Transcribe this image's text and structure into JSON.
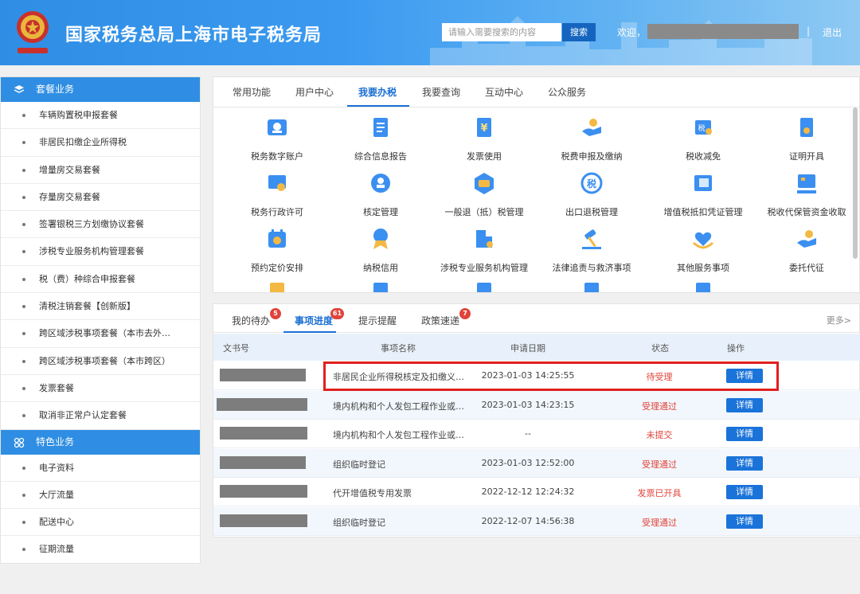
{
  "header": {
    "title": "国家税务总局上海市电子税务局",
    "search_placeholder": "请输入需要搜索的内容",
    "search_button": "搜索",
    "welcome": "欢迎，",
    "separator": "|",
    "logout": "退出"
  },
  "colors": {
    "brand_blue": "#2f8ee3",
    "accent_blue": "#1a6fd4",
    "status_red": "#e0443a",
    "highlight_red": "#e02020"
  },
  "sidebar": {
    "section1": {
      "title": "套餐业务",
      "icon": "layers-icon"
    },
    "items1": [
      "车辆购置税申报套餐",
      "非居民扣缴企业所得税",
      "增量房交易套餐",
      "存量房交易套餐",
      "签署银税三方划缴协议套餐",
      "涉税专业服务机构管理套餐",
      "税（费）种综合申报套餐",
      "清税注销套餐【创新版】",
      "跨区域涉税事项套餐（本市去外…",
      "跨区域涉税事项套餐（本市跨区）",
      "发票套餐",
      "取消非正常户认定套餐"
    ],
    "section2": {
      "title": "特色业务",
      "icon": "grid-icon"
    },
    "items2": [
      "电子资料",
      "大厅流量",
      "配送中心",
      "征期流量"
    ]
  },
  "top_tabs": [
    "常用功能",
    "用户中心",
    "我要办税",
    "我要查询",
    "互动中心",
    "公众服务"
  ],
  "top_tabs_active": "我要办税",
  "services": [
    {
      "label": "税务数字账户",
      "icon": "digital-account-icon"
    },
    {
      "label": "综合信息报告",
      "icon": "report-icon"
    },
    {
      "label": "发票使用",
      "icon": "invoice-icon"
    },
    {
      "label": "税费申报及缴纳",
      "icon": "payment-hand-icon"
    },
    {
      "label": "税收减免",
      "icon": "tax-relief-icon"
    },
    {
      "label": "证明开具",
      "icon": "certificate-icon"
    },
    {
      "label": "税务行政许可",
      "icon": "license-icon"
    },
    {
      "label": "核定管理",
      "icon": "stamp-icon"
    },
    {
      "label": "一般退（抵）税管理",
      "icon": "refund-icon"
    },
    {
      "label": "出口退税管理",
      "icon": "export-refund-icon"
    },
    {
      "label": "增值税抵扣凭证管理",
      "icon": "voucher-icon"
    },
    {
      "label": "税收代保管资金收取",
      "icon": "custody-icon"
    },
    {
      "label": "预约定价安排",
      "icon": "calendar-icon"
    },
    {
      "label": "纳税信用",
      "icon": "credit-medal-icon"
    },
    {
      "label": "涉税专业服务机构管理",
      "icon": "building-gear-icon"
    },
    {
      "label": "法律追责与救济事项",
      "icon": "gavel-icon"
    },
    {
      "label": "其他服务事项",
      "icon": "heart-hand-icon"
    },
    {
      "label": "委托代征",
      "icon": "entrust-icon"
    }
  ],
  "progress_tabs": [
    {
      "label": "我的待办",
      "badge": "5"
    },
    {
      "label": "事项进度",
      "badge": "61"
    },
    {
      "label": "提示提醒",
      "badge": ""
    },
    {
      "label": "政策速递",
      "badge": "7"
    }
  ],
  "progress_tabs_active": "事项进度",
  "more": "更多>",
  "table": {
    "headers": [
      "文书号",
      "事项名称",
      "申请日期",
      "状态",
      "操作"
    ],
    "rows": [
      {
        "name": "非居民企业所得税核定及扣缴义…",
        "date": "2023-01-03 14:25:55",
        "status": "待受理",
        "action": "详情"
      },
      {
        "name": "境内机构和个人发包工程作业或…",
        "date": "2023-01-03 14:23:15",
        "status": "受理通过",
        "action": "详情"
      },
      {
        "name": "境内机构和个人发包工程作业或…",
        "date": "--",
        "status": "未提交",
        "action": "详情"
      },
      {
        "name": "组织临时登记",
        "date": "2023-01-03 12:52:00",
        "status": "受理通过",
        "action": "详情"
      },
      {
        "name": "代开增值税专用发票",
        "date": "2022-12-12 12:24:32",
        "status": "发票已开具",
        "action": "详情"
      },
      {
        "name": "组织临时登记",
        "date": "2022-12-07 14:56:38",
        "status": "受理通过",
        "action": "详情"
      }
    ]
  }
}
